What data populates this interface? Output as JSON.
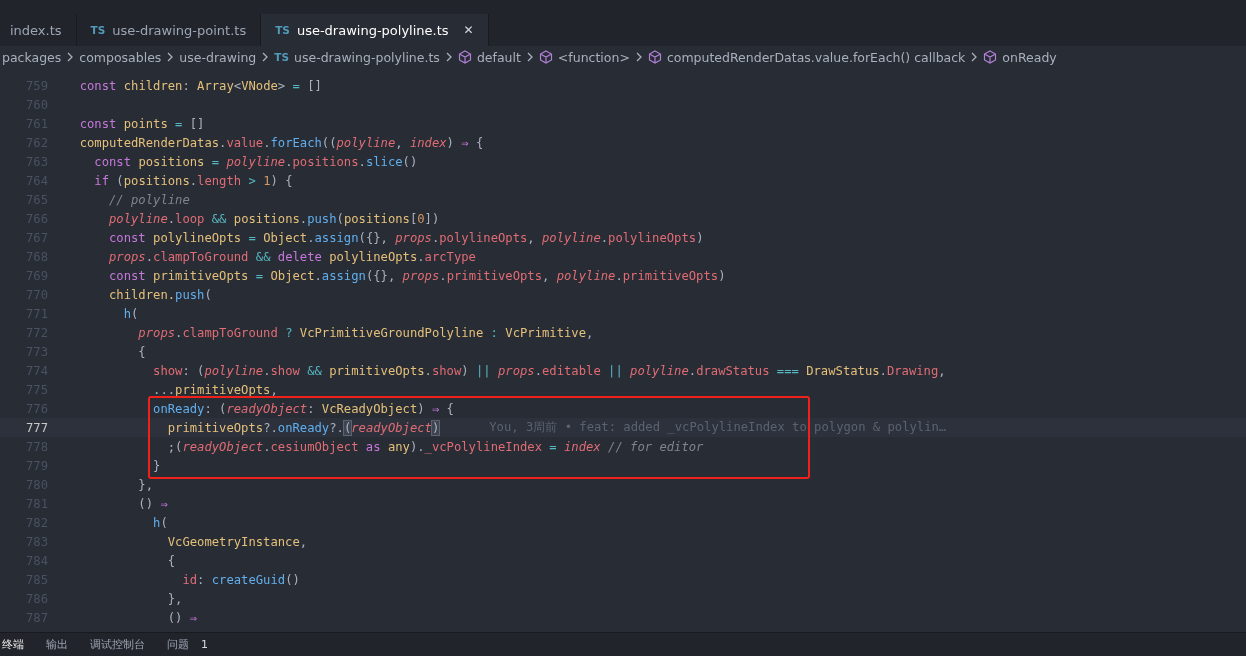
{
  "tabs": [
    {
      "label": "index.ts",
      "selected": false
    },
    {
      "label": "use-drawing-point.ts",
      "icon_text": "TS",
      "selected": false
    },
    {
      "label": "use-drawing-polyline.ts",
      "icon_text": "TS",
      "selected": true,
      "close": "✕"
    }
  ],
  "breadcrumb": [
    {
      "label": "packages",
      "kind": "folder"
    },
    {
      "label": "composables",
      "kind": "folder"
    },
    {
      "label": "use-drawing",
      "kind": "folder"
    },
    {
      "label": "use-drawing-polyline.ts",
      "kind": "file",
      "icon_text": "TS"
    },
    {
      "label": "default",
      "kind": "symbol"
    },
    {
      "label": "<function>",
      "kind": "symbol"
    },
    {
      "label": "computedRenderDatas.value.forEach() callback",
      "kind": "symbol"
    },
    {
      "label": "onReady",
      "kind": "symbol"
    }
  ],
  "editor": {
    "blocks": [
      {
        "boxed": false,
        "lines": [
          {
            "number": "759",
            "current": false,
            "tokens": [
              {
                "text": "  const",
                "kind": "k"
              },
              {
                "text": " children",
                "kind": "v"
              },
              {
                "text": ":",
                "kind": "t"
              },
              {
                "text": " Array",
                "kind": "v"
              },
              {
                "text": "<",
                "kind": "t"
              },
              {
                "text": "VNode",
                "kind": "v"
              },
              {
                "text": ">",
                "kind": "t"
              },
              {
                "text": " =",
                "kind": "o"
              },
              {
                "text": " []",
                "kind": "t"
              }
            ]
          },
          {
            "number": "760",
            "current": false
          },
          {
            "number": "761",
            "current": false,
            "tokens": [
              {
                "text": "  const",
                "kind": "k"
              },
              {
                "text": " points",
                "kind": "v"
              },
              {
                "text": " =",
                "kind": "o"
              },
              {
                "text": " []",
                "kind": "t"
              }
            ]
          },
          {
            "number": "762",
            "current": false,
            "tokens": [
              {
                "text": "  computedRenderDatas",
                "kind": "v"
              },
              {
                "text": ".",
                "kind": "t"
              },
              {
                "text": "value",
                "kind": "p"
              },
              {
                "text": ".",
                "kind": "t"
              },
              {
                "text": "forEach",
                "kind": "f"
              },
              {
                "text": "((",
                "kind": "t"
              },
              {
                "text": "polyline",
                "kind": "i"
              },
              {
                "text": ",",
                "kind": "t"
              },
              {
                "text": " index",
                "kind": "i"
              },
              {
                "text": ")",
                "kind": "t"
              },
              {
                "text": " ⇒",
                "kind": "k"
              },
              {
                "text": " {",
                "kind": "t"
              }
            ]
          },
          {
            "number": "763",
            "current": false,
            "tokens": [
              {
                "text": "    const",
                "kind": "k"
              },
              {
                "text": " positions",
                "kind": "v"
              },
              {
                "text": " =",
                "kind": "o"
              },
              {
                "text": " polyline",
                "kind": "i"
              },
              {
                "text": ".",
                "kind": "t"
              },
              {
                "text": "positions",
                "kind": "p"
              },
              {
                "text": ".",
                "kind": "t"
              },
              {
                "text": "slice",
                "kind": "f"
              },
              {
                "text": "()",
                "kind": "t"
              }
            ]
          },
          {
            "number": "764",
            "current": false,
            "tokens": [
              {
                "text": "    if",
                "kind": "k"
              },
              {
                "text": " (",
                "kind": "t"
              },
              {
                "text": "positions",
                "kind": "v"
              },
              {
                "text": ".",
                "kind": "t"
              },
              {
                "text": "length",
                "kind": "p"
              },
              {
                "text": " >",
                "kind": "o"
              },
              {
                "text": " 1",
                "kind": "n"
              },
              {
                "text": ") {",
                "kind": "t"
              }
            ]
          },
          {
            "number": "765",
            "current": false,
            "tokens": [
              {
                "text": "      // polyline",
                "kind": "c"
              }
            ]
          },
          {
            "number": "766",
            "current": false,
            "tokens": [
              {
                "text": "      polyline",
                "kind": "i"
              },
              {
                "text": ".",
                "kind": "t"
              },
              {
                "text": "loop",
                "kind": "p"
              },
              {
                "text": " &&",
                "kind": "o"
              },
              {
                "text": " positions",
                "kind": "v"
              },
              {
                "text": ".",
                "kind": "t"
              },
              {
                "text": "push",
                "kind": "f"
              },
              {
                "text": "(",
                "kind": "t"
              },
              {
                "text": "positions",
                "kind": "v"
              },
              {
                "text": "[",
                "kind": "t"
              },
              {
                "text": "0",
                "kind": "n"
              },
              {
                "text": "])",
                "kind": "t"
              }
            ]
          },
          {
            "number": "767",
            "current": false,
            "tokens": [
              {
                "text": "      const",
                "kind": "k"
              },
              {
                "text": " polylineOpts",
                "kind": "v"
              },
              {
                "text": " =",
                "kind": "o"
              },
              {
                "text": " Object",
                "kind": "v"
              },
              {
                "text": ".",
                "kind": "t"
              },
              {
                "text": "assign",
                "kind": "f"
              },
              {
                "text": "({},",
                "kind": "t"
              },
              {
                "text": " props",
                "kind": "i"
              },
              {
                "text": ".",
                "kind": "t"
              },
              {
                "text": "polylineOpts",
                "kind": "p"
              },
              {
                "text": ",",
                "kind": "t"
              },
              {
                "text": " polyline",
                "kind": "i"
              },
              {
                "text": ".",
                "kind": "t"
              },
              {
                "text": "polylineOpts",
                "kind": "p"
              },
              {
                "text": ")",
                "kind": "t"
              }
            ]
          },
          {
            "number": "768",
            "current": false,
            "tokens": [
              {
                "text": "      props",
                "kind": "i"
              },
              {
                "text": ".",
                "kind": "t"
              },
              {
                "text": "clampToGround",
                "kind": "p"
              },
              {
                "text": " &&",
                "kind": "o"
              },
              {
                "text": " delete",
                "kind": "k"
              },
              {
                "text": " polylineOpts",
                "kind": "v"
              },
              {
                "text": ".",
                "kind": "t"
              },
              {
                "text": "arcType",
                "kind": "p"
              }
            ]
          },
          {
            "number": "769",
            "current": false,
            "tokens": [
              {
                "text": "      const",
                "kind": "k"
              },
              {
                "text": " primitiveOpts",
                "kind": "v"
              },
              {
                "text": " =",
                "kind": "o"
              },
              {
                "text": " Object",
                "kind": "v"
              },
              {
                "text": ".",
                "kind": "t"
              },
              {
                "text": "assign",
                "kind": "f"
              },
              {
                "text": "({},",
                "kind": "t"
              },
              {
                "text": " props",
                "kind": "i"
              },
              {
                "text": ".",
                "kind": "t"
              },
              {
                "text": "primitiveOpts",
                "kind": "p"
              },
              {
                "text": ",",
                "kind": "t"
              },
              {
                "text": " polyline",
                "kind": "i"
              },
              {
                "text": ".",
                "kind": "t"
              },
              {
                "text": "primitiveOpts",
                "kind": "p"
              },
              {
                "text": ")",
                "kind": "t"
              }
            ]
          },
          {
            "number": "770",
            "current": false,
            "tokens": [
              {
                "text": "      children.",
                "kind": "v"
              },
              {
                "text": "push",
                "kind": "f"
              },
              {
                "text": "(",
                "kind": "t"
              }
            ]
          },
          {
            "number": "771",
            "current": false,
            "tokens": [
              {
                "text": "        h",
                "kind": "f"
              },
              {
                "text": "(",
                "kind": "t"
              }
            ]
          },
          {
            "number": "772",
            "current": false,
            "tokens": [
              {
                "text": "          props",
                "kind": "i"
              },
              {
                "text": ".",
                "kind": "t"
              },
              {
                "text": "clampToGround",
                "kind": "p"
              },
              {
                "text": " ?",
                "kind": "o"
              },
              {
                "text": " VcPrimitiveGroundPolyline",
                "kind": "v"
              },
              {
                "text": " :",
                "kind": "o"
              },
              {
                "text": " VcPrimitive",
                "kind": "v"
              },
              {
                "text": ",",
                "kind": "t"
              }
            ]
          },
          {
            "number": "773",
            "current": false,
            "tokens": [
              {
                "text": "          {",
                "kind": "t"
              }
            ]
          },
          {
            "number": "774",
            "current": false,
            "tokens": [
              {
                "text": "            show",
                "kind": "p"
              },
              {
                "text": ": (",
                "kind": "t"
              },
              {
                "text": "polyline",
                "kind": "i"
              },
              {
                "text": ".",
                "kind": "t"
              },
              {
                "text": "show",
                "kind": "p"
              },
              {
                "text": " &&",
                "kind": "o"
              },
              {
                "text": " primitiveOpts",
                "kind": "v"
              },
              {
                "text": ".",
                "kind": "t"
              },
              {
                "text": "show",
                "kind": "p"
              },
              {
                "text": ")",
                "kind": "t"
              },
              {
                "text": " ||",
                "kind": "o"
              },
              {
                "text": " props",
                "kind": "i"
              },
              {
                "text": ".",
                "kind": "t"
              },
              {
                "text": "editable",
                "kind": "p"
              },
              {
                "text": " ||",
                "kind": "o"
              },
              {
                "text": " polyline",
                "kind": "i"
              },
              {
                "text": ".",
                "kind": "t"
              },
              {
                "text": "drawStatus",
                "kind": "p"
              },
              {
                "text": " ===",
                "kind": "o"
              },
              {
                "text": " DrawStatus",
                "kind": "v"
              },
              {
                "text": ".",
                "kind": "t"
              },
              {
                "text": "Drawing",
                "kind": "p"
              },
              {
                "text": ",",
                "kind": "t"
              }
            ]
          },
          {
            "number": "775",
            "current": false,
            "tokens": [
              {
                "text": "            ...",
                "kind": "t"
              },
              {
                "text": "primitiveOpts",
                "kind": "v"
              },
              {
                "text": ",",
                "kind": "t"
              }
            ]
          }
        ]
      },
      {
        "boxed": true,
        "lines": [
          {
            "number": "776",
            "current": false,
            "tokens": [
              {
                "text": "            onReady",
                "kind": "f"
              },
              {
                "text": ": (",
                "kind": "t"
              },
              {
                "text": "readyObject",
                "kind": "i"
              },
              {
                "text": ":",
                "kind": "t"
              },
              {
                "text": " VcReadyObject",
                "kind": "v"
              },
              {
                "text": ")",
                "kind": "t"
              },
              {
                "text": " ⇒",
                "kind": "k"
              },
              {
                "text": " {",
                "kind": "t"
              }
            ]
          },
          {
            "number": "777",
            "current": true,
            "tokens": [
              {
                "text": "              primitiveOpts",
                "kind": "v"
              },
              {
                "text": "?.",
                "kind": "t"
              },
              {
                "text": "onReady",
                "kind": "f"
              },
              {
                "text": "?.",
                "kind": "t"
              },
              {
                "text": "(",
                "kind": "b"
              },
              {
                "text": "readyObject",
                "kind": "i"
              },
              {
                "text": ")",
                "kind": "b"
              }
            ],
            "blame": "You, 3周前 • feat: added _vcPolylineIndex to polygon & polylin…"
          },
          {
            "number": "778",
            "current": false,
            "tokens": [
              {
                "text": "              ;(",
                "kind": "t"
              },
              {
                "text": "readyObject",
                "kind": "i"
              },
              {
                "text": ".",
                "kind": "t"
              },
              {
                "text": "cesiumObject",
                "kind": "p"
              },
              {
                "text": " as",
                "kind": "k"
              },
              {
                "text": " any",
                "kind": "v"
              },
              {
                "text": ").",
                "kind": "t"
              },
              {
                "text": "_vcPolylineIndex",
                "kind": "p"
              },
              {
                "text": " =",
                "kind": "o"
              },
              {
                "text": " index",
                "kind": "i"
              },
              {
                "text": " // for editor",
                "kind": "c"
              }
            ]
          },
          {
            "number": "779",
            "current": false,
            "tokens": [
              {
                "text": "            }",
                "kind": "t"
              }
            ]
          }
        ]
      },
      {
        "boxed": false,
        "lines": [
          {
            "number": "780",
            "current": false,
            "tokens": [
              {
                "text": "          },",
                "kind": "t"
              }
            ]
          },
          {
            "number": "781",
            "current": false,
            "tokens": [
              {
                "text": "          ()",
                "kind": "t"
              },
              {
                "text": " ⇒",
                "kind": "k"
              }
            ]
          },
          {
            "number": "782",
            "current": false,
            "tokens": [
              {
                "text": "            h",
                "kind": "f"
              },
              {
                "text": "(",
                "kind": "t"
              }
            ]
          },
          {
            "number": "783",
            "current": false,
            "tokens": [
              {
                "text": "              VcGeometryInstance",
                "kind": "v"
              },
              {
                "text": ",",
                "kind": "t"
              }
            ]
          },
          {
            "number": "784",
            "current": false,
            "tokens": [
              {
                "text": "              {",
                "kind": "t"
              }
            ]
          },
          {
            "number": "785",
            "current": false,
            "tokens": [
              {
                "text": "                id",
                "kind": "p"
              },
              {
                "text": ":",
                "kind": "t"
              },
              {
                "text": " createGuid",
                "kind": "f"
              },
              {
                "text": "()",
                "kind": "t"
              }
            ]
          },
          {
            "number": "786",
            "current": false,
            "tokens": [
              {
                "text": "              },",
                "kind": "t"
              }
            ]
          },
          {
            "number": "787",
            "current": false,
            "tokens": [
              {
                "text": "              ()",
                "kind": "t"
              },
              {
                "text": " ⇒",
                "kind": "k"
              }
            ]
          }
        ]
      }
    ]
  },
  "panel": {
    "tabs": [
      {
        "label": "终端",
        "selected": true
      },
      {
        "label": "输出",
        "selected": false
      },
      {
        "label": "调试控制台",
        "selected": false
      },
      {
        "label": "问题",
        "selected": false,
        "badge": "1"
      }
    ]
  }
}
